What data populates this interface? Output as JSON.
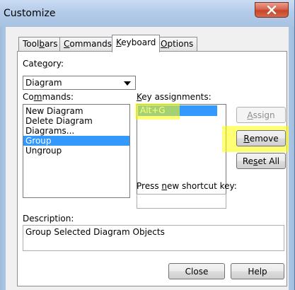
{
  "window": {
    "title": "Customize",
    "close_glyph": "X"
  },
  "tabs": {
    "toolbars": {
      "pre": "Tool",
      "key": "b",
      "post": "ars"
    },
    "commands": {
      "pre": "",
      "key": "C",
      "post": "ommands"
    },
    "keyboard": {
      "pre": "",
      "key": "K",
      "post": "eyboard"
    },
    "options": {
      "pre": "",
      "key": "O",
      "post": "ptions"
    }
  },
  "category": {
    "label_pre": "Cate",
    "label_key": "g",
    "label_post": "ory:",
    "value": "Diagram"
  },
  "commands": {
    "label_pre": "Co",
    "label_key": "m",
    "label_post": "mands:",
    "items": [
      "New Diagram",
      "Delete Diagram",
      "Diagrams...",
      "Group",
      "Ungroup"
    ],
    "selected": "Group"
  },
  "key_assignments": {
    "label_pre": "",
    "label_key": "K",
    "label_post": "ey assignments:",
    "items": [
      "Alt+G"
    ]
  },
  "buttons": {
    "assign": {
      "pre": "",
      "key": "A",
      "post": "ssign"
    },
    "remove": {
      "pre": "",
      "key": "R",
      "post": "emove"
    },
    "reset_all": {
      "pre": "Re",
      "key": "s",
      "post": "et All"
    },
    "close": "Close",
    "help": "Help"
  },
  "shortcut": {
    "label_pre": "Press ",
    "label_key": "n",
    "label_post": "ew shortcut key:",
    "value": ""
  },
  "description": {
    "label": "Description:",
    "text": "Group Selected Diagram Objects"
  },
  "colors": {
    "selection": "#3399ff",
    "highlight": "#ffff00"
  }
}
